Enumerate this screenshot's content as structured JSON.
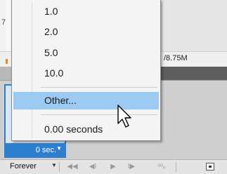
{
  "menu": {
    "items": [
      {
        "label": "1.0",
        "highlighted": false
      },
      {
        "label": "2.0",
        "highlighted": false
      },
      {
        "label": "5.0",
        "highlighted": false
      },
      {
        "label": "10.0",
        "highlighted": false
      },
      {
        "label": "Other...",
        "highlighted": true
      },
      {
        "label": "0.00 seconds",
        "highlighted": false
      }
    ]
  },
  "background": {
    "file_size_text": "/8.75M",
    "edge_glyph": "7"
  },
  "frame": {
    "delay_label": "0 sec."
  },
  "toolbar": {
    "loop_option": "Forever"
  },
  "colors": {
    "highlight": "#9ccaf2",
    "selection_blue": "#2f7fd0",
    "accent_orange": "#e08a2c"
  }
}
